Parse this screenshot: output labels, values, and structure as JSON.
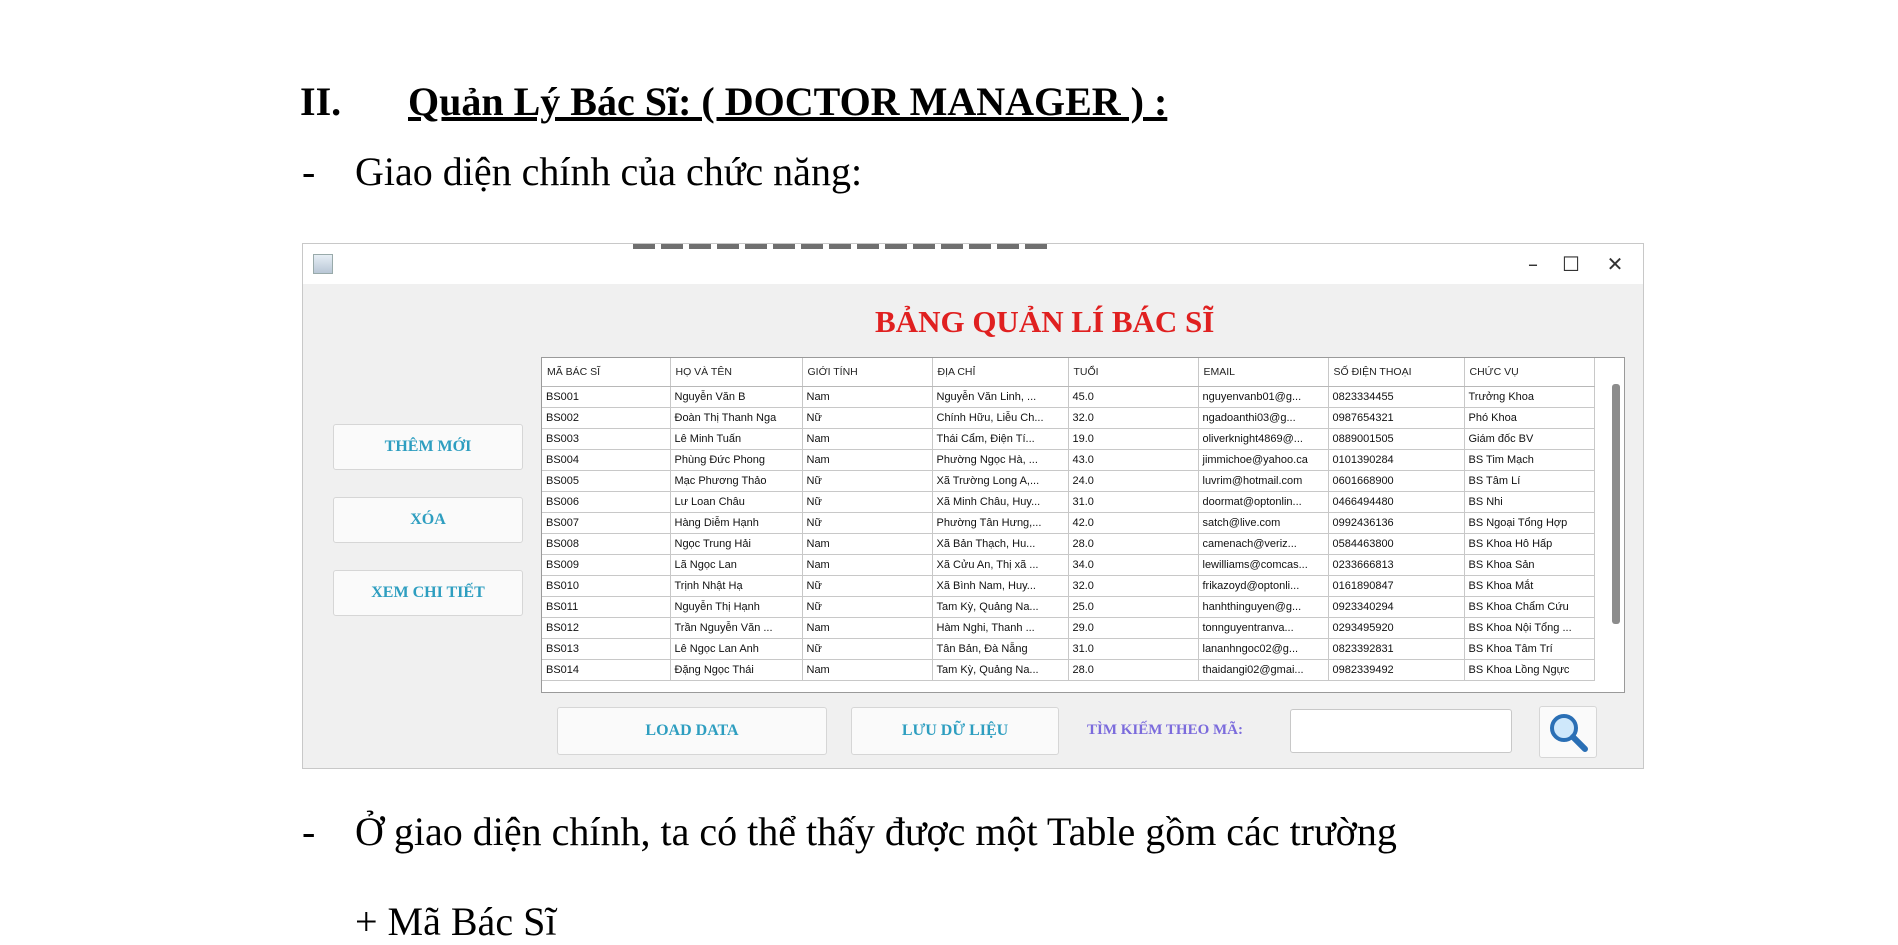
{
  "heading": {
    "number": "II.",
    "title": "Quản Lý Bác Sĩ: ( DOCTOR MANAGER ) :"
  },
  "paragraph1": {
    "bullet": "-",
    "text": "Giao diện chính của chức năng:"
  },
  "window": {
    "controls": {
      "minimize": "–",
      "maximize": "☐",
      "close": "✕"
    },
    "title": "BẢNG QUẢN LÍ BÁC SĨ",
    "side_buttons": {
      "add": "THÊM MỚI",
      "delete": "XÓA",
      "details": "XEM CHI TIẾT"
    },
    "bottom_buttons": {
      "load": "LOAD DATA",
      "save": "LƯU DỮ LIỆU"
    },
    "search": {
      "label": "TÌM KIẾM THEO MÃ:",
      "value": ""
    },
    "table": {
      "columns": [
        "MÃ BÁC SĨ",
        "HỌ VÀ TÊN",
        "GIỚI TÍNH",
        "ĐỊA CHỈ",
        "TUỔI",
        "EMAIL",
        "SỐ ĐIỆN THOẠI",
        "CHỨC VỤ"
      ],
      "rows": [
        [
          "BS001",
          "Nguyễn Văn B",
          "Nam",
          "Nguyễn Văn Linh, ...",
          "45.0",
          "nguyenvanb01@g...",
          "0823334455",
          "Trưởng Khoa"
        ],
        [
          "BS002",
          "Đoàn Thị Thanh Nga",
          "Nữ",
          "Chính Hữu, Liễu Ch...",
          "32.0",
          "ngadoanthi03@g...",
          "0987654321",
          "Phó Khoa"
        ],
        [
          "BS003",
          "Lê Minh Tuấn",
          "Nam",
          "Thái Cẩm, Điện Tí...",
          "19.0",
          "oliverknight4869@...",
          "0889001505",
          "Giám đốc BV"
        ],
        [
          "BS004",
          "Phùng Đức Phong",
          "Nam",
          "Phường Ngọc Hà, ...",
          "43.0",
          "jimmichoe@yahoo.ca",
          "0101390284",
          "BS Tim Mạch"
        ],
        [
          "BS005",
          "Mạc Phương Thảo",
          "Nữ",
          "Xã Trường Long A,...",
          "24.0",
          "luvrim@hotmail.com",
          "0601668900",
          "BS Tâm Lí"
        ],
        [
          "BS006",
          "Lư Loan Châu",
          "Nữ",
          "Xã Minh Châu, Huy...",
          "31.0",
          "doormat@optonlin...",
          "0466494480",
          "BS Nhi"
        ],
        [
          "BS007",
          "Hàng Diễm Hạnh",
          "Nữ",
          "Phường Tân Hưng,...",
          "42.0",
          "satch@live.com",
          "0992436136",
          "BS Ngoại Tổng Hợp"
        ],
        [
          "BS008",
          "Ngọc Trung Hải",
          "Nam",
          "Xã Bản Thạch, Hu...",
          "28.0",
          "camenach@veriz...",
          "0584463800",
          "BS Khoa Hô Hấp"
        ],
        [
          "BS009",
          "Lã Ngọc Lan",
          "Nam",
          "Xã Cửu An, Thị xã ...",
          "34.0",
          "lewilliams@comcas...",
          "0233666813",
          "BS Khoa Sản"
        ],
        [
          "BS010",
          "Trịnh Nhật Hạ",
          "Nữ",
          "Xã Bình Nam, Huy...",
          "32.0",
          "frikazoyd@optonli...",
          "0161890847",
          "BS Khoa Mắt"
        ],
        [
          "BS011",
          "Nguyễn Thị Hạnh",
          "Nữ",
          "Tam Kỳ, Quảng Na...",
          "25.0",
          "hanhthinguyen@g...",
          "0923340294",
          "BS Khoa Chẩm Cứu"
        ],
        [
          "BS012",
          "Trần Nguyễn Văn ...",
          "Nam",
          "Hàm Nghi, Thanh ...",
          "29.0",
          "tonnguyentranva...",
          "0293495920",
          "BS Khoa Nội Tổng ..."
        ],
        [
          "BS013",
          "Lê Ngọc Lan Anh",
          "Nữ",
          "Tân Bản, Đà Nẵng",
          "31.0",
          "lananhngoc02@g...",
          "0823392831",
          "BS Khoa Tâm Trí"
        ],
        [
          "BS014",
          "Đặng Ngọc Thái",
          "Nam",
          "Tam Kỳ, Quảng Na...",
          "28.0",
          "thaidangi02@gmai...",
          "0982339492",
          "BS Khoa Lồng Ngực"
        ]
      ]
    }
  },
  "paragraph2": {
    "bullet": "-",
    "text": "Ở giao diện chính, ta có thể thấy được một Table gồm các trường"
  },
  "sub_item": {
    "text": "+ Mã Bác Sĩ"
  },
  "colors": {
    "title_red": "#e02020",
    "button_blue": "#2e9ec0",
    "search_purple": "#7b6bdc"
  },
  "icons": {
    "app": "java-app-icon",
    "search": "magnifier-icon"
  }
}
